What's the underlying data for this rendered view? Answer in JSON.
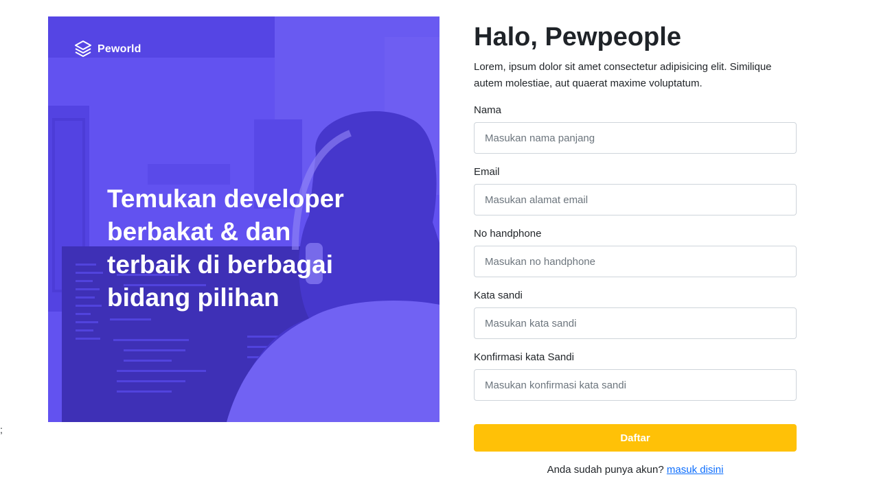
{
  "stray_text": ";",
  "hero": {
    "brand_name": "Peworld",
    "headline": "Temukan developer berbakat & dan terbaik di berbagai bidang pilihan"
  },
  "form": {
    "title": "Halo, Pewpeople",
    "subtitle": "Lorem, ipsum dolor sit amet consectetur adipisicing elit. Similique autem molestiae, aut quaerat maxime voluptatum.",
    "fields": [
      {
        "label": "Nama",
        "placeholder": "Masukan nama panjang",
        "value": ""
      },
      {
        "label": "Email",
        "placeholder": "Masukan alamat email",
        "value": ""
      },
      {
        "label": "No handphone",
        "placeholder": "Masukan no handphone",
        "value": ""
      },
      {
        "label": "Kata sandi",
        "placeholder": "Masukan kata sandi",
        "value": ""
      },
      {
        "label": "Konfirmasi kata Sandi",
        "placeholder": "Masukan konfirmasi kata sandi",
        "value": ""
      }
    ],
    "submit_label": "Daftar",
    "login_prompt": "Anda sudah punya akun?",
    "login_link": "masuk disini"
  },
  "colors": {
    "hero_tint": "#5b4bf0",
    "submit_bg": "#ffc107",
    "link": "#0d6efd"
  }
}
